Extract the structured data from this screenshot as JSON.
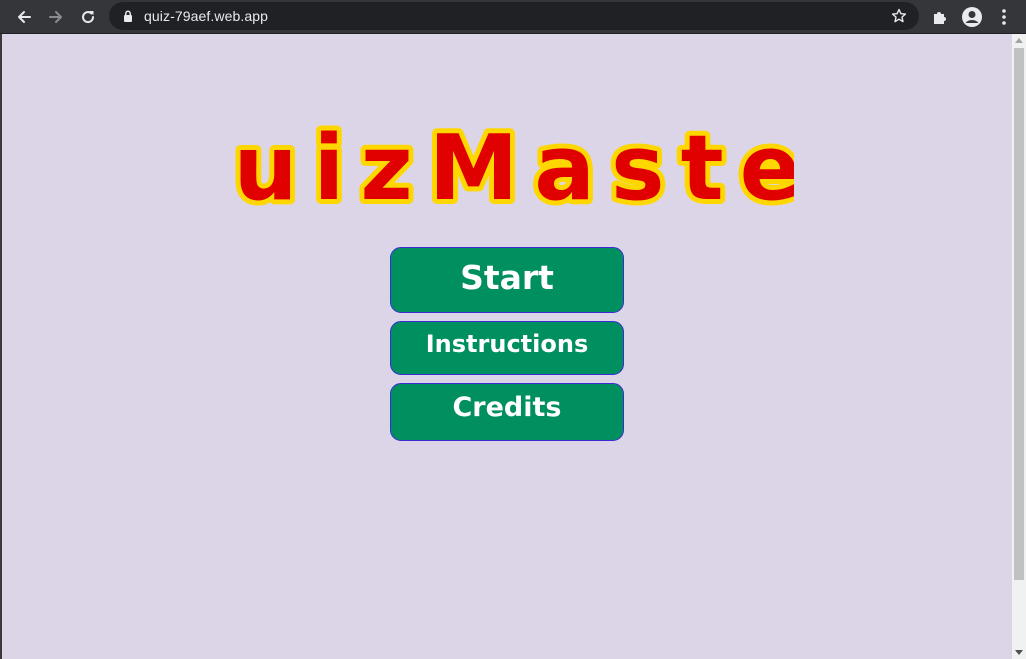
{
  "browser": {
    "url": "quiz-79aef.web.app",
    "icons": {
      "back": "arrow-left-icon",
      "forward": "arrow-right-icon",
      "reload": "reload-icon",
      "lock": "lock-icon",
      "bookmark": "star-icon",
      "extensions": "puzzle-icon",
      "profile": "account-icon",
      "menu": "kebab-icon"
    }
  },
  "page": {
    "logo_text": "QuizMaster",
    "buttons": {
      "start": "Start",
      "instructions": "Instructions",
      "credits": "Credits"
    }
  },
  "colors": {
    "page_background": "#dcd5e8",
    "button_fill": "#008f5e",
    "button_border": "#3b2bd4",
    "logo_fill": "#e00000",
    "logo_outline": "#ffd700"
  }
}
